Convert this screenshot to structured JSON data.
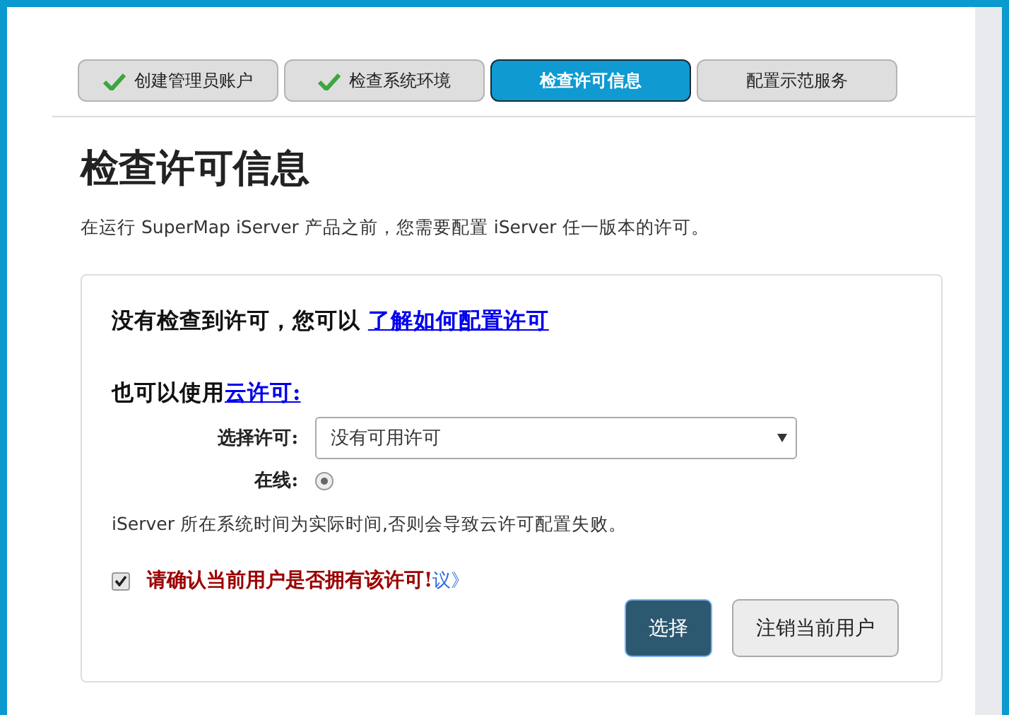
{
  "steps": [
    {
      "label": "创建管理员账户",
      "done": true,
      "selected": false
    },
    {
      "label": "检查系统环境",
      "done": true,
      "selected": false
    },
    {
      "label": "检查许可信息",
      "done": false,
      "selected": true
    },
    {
      "label": "配置示范服务",
      "done": false,
      "selected": false
    }
  ],
  "title": "检查许可信息",
  "description": "在运行 SuperMap iServer 产品之前，您需要配置 iServer 任一版本的许可。",
  "no_license": {
    "text": "没有检查到许可，您可以 ",
    "link": "了解如何配置许可"
  },
  "cloud": {
    "text": "也可以使用",
    "link": "云许可:"
  },
  "select_license": {
    "label": "选择许可:",
    "value": "没有可用许可"
  },
  "online": {
    "label": "在线:",
    "selected": true
  },
  "note": "iServer 所在系统时间为实际时间,否则会导致云许可配置失败。",
  "agreement": {
    "checked": true,
    "link": "议》"
  },
  "warning": "请确认当前用户是否拥有该许可!",
  "buttons": [
    {
      "label": "选择",
      "kind": "primary"
    },
    {
      "label": "注销当前用户",
      "kind": "default"
    }
  ]
}
